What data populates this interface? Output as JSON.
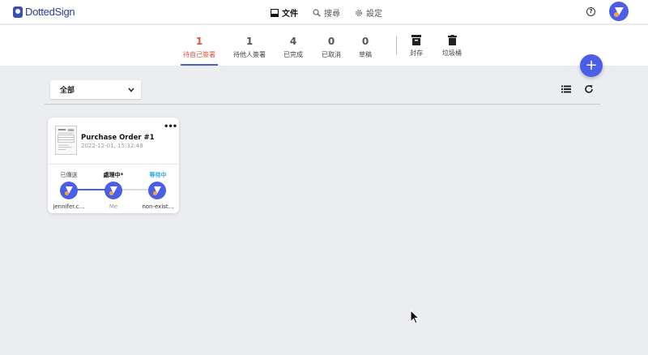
{
  "app": {
    "logo_text": "DottedSign"
  },
  "nav": [
    {
      "label": "文件",
      "icon": "document-icon",
      "active": true
    },
    {
      "label": "搜尋",
      "icon": "search-icon",
      "active": false
    },
    {
      "label": "設定",
      "icon": "gear-icon",
      "active": false
    }
  ],
  "header": {
    "help_icon": "help-icon",
    "help_glyph": "?"
  },
  "stats": [
    {
      "count": "1",
      "label": "待自己簽署",
      "active": true
    },
    {
      "count": "1",
      "label": "待他人簽署"
    },
    {
      "count": "4",
      "label": "已完成"
    },
    {
      "count": "0",
      "label": "已取消"
    },
    {
      "count": "0",
      "label": "草稿"
    }
  ],
  "archive": {
    "label": "封存",
    "icon": "archive-icon"
  },
  "trash": {
    "label": "垃圾桶",
    "icon": "trash-icon"
  },
  "fab": {
    "glyph": "+",
    "icon": "add-icon"
  },
  "filter": {
    "value": "全部"
  },
  "card": {
    "title": "Purchase Order #1",
    "date": "2022-12-01, 15:32:48",
    "menu_glyph": "•••",
    "steps": [
      {
        "status": "已傳送",
        "name": "jennifer.c…",
        "status_color": "#444444"
      },
      {
        "status": "處理中*",
        "name": "Me",
        "status_color": "#111111"
      },
      {
        "status": "等待中",
        "name": "non-exist…",
        "status_color": "#2aa8d8"
      }
    ]
  },
  "colors": {
    "accent": "#4a5ee8",
    "active_tab": "#e0543a",
    "brand": "#2d3a9e"
  }
}
